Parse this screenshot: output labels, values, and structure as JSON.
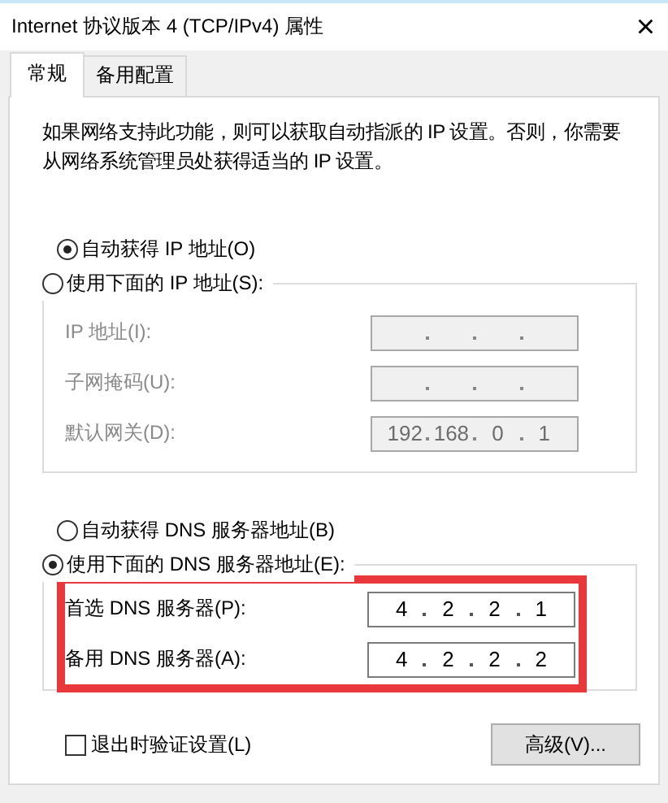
{
  "window": {
    "title": "Internet 协议版本 4 (TCP/IPv4) 属性",
    "close": "×"
  },
  "tabs": [
    {
      "label": "常规",
      "selected": true
    },
    {
      "label": "备用配置",
      "selected": false
    }
  ],
  "description": "如果网络支持此功能，则可以获取自动指派的 IP 设置。否则，你需要从网络系统管理员处获得适当的 IP 设置。",
  "ip": {
    "options": [
      {
        "label": "自动获得 IP 地址(O)",
        "selected": true
      },
      {
        "label": "使用下面的 IP 地址(S):",
        "selected": false
      }
    ],
    "fields": [
      {
        "label": "IP 地址(I):",
        "disabled": true
      },
      {
        "label": "子网掩码(U):",
        "disabled": true
      },
      {
        "label": "默认网关(D):",
        "disabled": true,
        "octets": [
          "192",
          "168",
          "0",
          "1"
        ]
      }
    ]
  },
  "dns": {
    "highlighted": true,
    "options": [
      {
        "label": "自动获得 DNS 服务器地址(B)",
        "selected": false
      },
      {
        "label": "使用下面的 DNS 服务器地址(E):",
        "selected": true
      }
    ],
    "fields": [
      {
        "label": "首选 DNS 服务器(P):",
        "disabled": false,
        "octets": [
          "4",
          "2",
          "2",
          "1"
        ]
      },
      {
        "label": "备用 DNS 服务器(A):",
        "disabled": false,
        "octets": [
          "4",
          "2",
          "2",
          "2"
        ]
      }
    ]
  },
  "validate": {
    "label": "退出时验证设置(L)",
    "checked": false
  },
  "advanced_button": "高级(V)..."
}
